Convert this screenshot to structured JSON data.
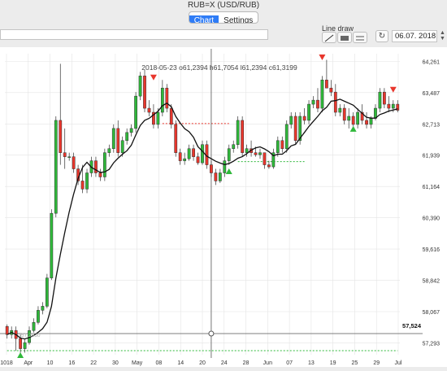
{
  "window": {
    "title": "RUB=X (USD/RUB)"
  },
  "tabs": [
    {
      "label": "Chart",
      "active": true
    },
    {
      "label": "Settings",
      "active": false
    }
  ],
  "toolbar": {
    "symbol_value": "",
    "line_draw_label": "Line draw",
    "date_value": "06.07. 2018"
  },
  "chart_data": {
    "type": "candlestick",
    "info_label": "2018-05-23 o61,2394 h61,7054 l61,2394 c61,3199",
    "y_ticks": [
      "64,261",
      "63,487",
      "62,713",
      "61,939",
      "61,164",
      "60,390",
      "59,616",
      "58,842",
      "58,067",
      "57,293"
    ],
    "x_ticks": [
      "1018",
      "Apr",
      "10",
      "16",
      "22",
      "30",
      "May",
      "08",
      "14",
      "20",
      "24",
      "28",
      "Jun",
      "07",
      "13",
      "19",
      "25",
      "29",
      "Jul"
    ],
    "crosshair_value": "57,524",
    "low_label": "57,2930",
    "ylim": [
      57.0,
      64.45
    ],
    "colors": {
      "up": "#2fb83a",
      "down": "#e8362c",
      "ma": "#111111",
      "grid": "#e4e4e4"
    },
    "candles": [
      [
        57.7,
        57.75,
        57.4,
        57.5
      ],
      [
        57.5,
        57.7,
        57.4,
        57.6
      ],
      [
        57.6,
        57.7,
        57.1,
        57.4
      ],
      [
        57.4,
        57.5,
        57.0,
        57.15
      ],
      [
        57.15,
        57.4,
        57.05,
        57.3
      ],
      [
        57.3,
        57.7,
        57.25,
        57.6
      ],
      [
        57.6,
        57.9,
        57.55,
        57.8
      ],
      [
        57.8,
        58.2,
        57.75,
        58.1
      ],
      [
        58.1,
        58.3,
        58.0,
        58.2
      ],
      [
        58.2,
        59.0,
        58.15,
        58.9
      ],
      [
        58.9,
        60.6,
        58.85,
        60.5
      ],
      [
        60.5,
        62.9,
        60.4,
        62.8
      ],
      [
        62.8,
        64.2,
        61.7,
        62.0
      ],
      [
        62.0,
        62.6,
        61.6,
        61.9
      ],
      [
        61.9,
        62.0,
        61.8,
        61.9
      ],
      [
        61.9,
        62.0,
        61.5,
        61.6
      ],
      [
        61.6,
        61.7,
        61.2,
        61.3
      ],
      [
        61.3,
        61.7,
        61.0,
        61.1
      ],
      [
        61.1,
        61.6,
        61.0,
        61.5
      ],
      [
        61.5,
        61.9,
        61.4,
        61.8
      ],
      [
        61.8,
        61.9,
        61.4,
        61.5
      ],
      [
        61.5,
        61.6,
        61.3,
        61.4
      ],
      [
        61.4,
        62.1,
        61.3,
        62.0
      ],
      [
        62.0,
        62.2,
        61.9,
        62.1
      ],
      [
        62.1,
        62.7,
        62.0,
        62.6
      ],
      [
        62.6,
        62.8,
        61.9,
        62.0
      ],
      [
        62.0,
        62.4,
        61.9,
        62.3
      ],
      [
        62.3,
        62.6,
        62.2,
        62.5
      ],
      [
        62.5,
        62.7,
        62.4,
        62.6
      ],
      [
        62.6,
        63.5,
        62.5,
        63.4
      ],
      [
        63.4,
        64.0,
        63.3,
        63.9
      ],
      [
        63.9,
        64.05,
        63.0,
        63.1
      ],
      [
        63.1,
        63.3,
        62.9,
        63.0
      ],
      [
        63.0,
        63.2,
        62.6,
        62.7
      ],
      [
        62.7,
        63.1,
        62.6,
        63.0
      ],
      [
        63.0,
        63.8,
        62.9,
        63.6
      ],
      [
        63.6,
        63.7,
        63.0,
        63.1
      ],
      [
        63.1,
        63.2,
        62.6,
        62.7
      ],
      [
        62.7,
        62.8,
        61.9,
        62.0
      ],
      [
        62.0,
        62.1,
        61.7,
        61.8
      ],
      [
        61.8,
        62.0,
        61.7,
        61.85
      ],
      [
        61.85,
        62.2,
        61.8,
        62.1
      ],
      [
        62.1,
        62.2,
        61.8,
        61.9
      ],
      [
        61.9,
        62.0,
        61.7,
        61.75
      ],
      [
        61.75,
        62.3,
        61.7,
        62.2
      ],
      [
        62.2,
        62.3,
        61.6,
        61.7
      ],
      [
        61.7,
        61.8,
        61.4,
        61.5
      ],
      [
        61.5,
        61.6,
        61.2,
        61.3
      ],
      [
        61.3,
        61.6,
        61.25,
        61.5
      ],
      [
        61.5,
        61.9,
        61.4,
        61.8
      ],
      [
        61.8,
        62.2,
        61.7,
        62.1
      ],
      [
        62.1,
        62.3,
        62.0,
        62.2
      ],
      [
        62.2,
        62.9,
        62.1,
        62.8
      ],
      [
        62.8,
        62.9,
        61.9,
        62.0
      ],
      [
        62.0,
        62.2,
        61.9,
        62.1
      ],
      [
        62.1,
        62.3,
        61.9,
        62.0
      ],
      [
        62.0,
        62.15,
        61.9,
        61.95
      ],
      [
        61.95,
        62.1,
        61.85,
        62.0
      ],
      [
        62.0,
        62.0,
        61.6,
        61.7
      ],
      [
        61.7,
        61.8,
        61.6,
        61.65
      ],
      [
        61.65,
        62.1,
        61.6,
        62.0
      ],
      [
        62.0,
        62.4,
        61.9,
        62.3
      ],
      [
        62.3,
        62.4,
        62.0,
        62.1
      ],
      [
        62.1,
        62.8,
        62.0,
        62.7
      ],
      [
        62.7,
        63.0,
        62.6,
        62.9
      ],
      [
        62.9,
        63.0,
        62.2,
        62.3
      ],
      [
        62.3,
        63.0,
        62.2,
        62.9
      ],
      [
        62.9,
        63.1,
        62.7,
        62.8
      ],
      [
        62.8,
        63.3,
        62.7,
        63.2
      ],
      [
        63.2,
        63.4,
        63.1,
        63.3
      ],
      [
        63.3,
        63.6,
        63.0,
        63.1
      ],
      [
        63.1,
        63.9,
        63.0,
        63.8
      ],
      [
        63.8,
        64.3,
        63.7,
        63.6
      ],
      [
        63.6,
        63.8,
        63.4,
        63.5
      ],
      [
        63.5,
        63.7,
        62.9,
        63.0
      ],
      [
        63.0,
        63.2,
        62.9,
        63.1
      ],
      [
        63.1,
        63.2,
        62.7,
        62.8
      ],
      [
        62.8,
        63.1,
        62.6,
        62.9
      ],
      [
        62.9,
        63.0,
        62.6,
        62.7
      ],
      [
        62.7,
        63.1,
        62.6,
        63.0
      ],
      [
        63.0,
        63.2,
        62.7,
        62.8
      ],
      [
        62.8,
        63.0,
        62.6,
        62.7
      ],
      [
        62.7,
        62.9,
        62.6,
        62.85
      ],
      [
        62.85,
        63.2,
        62.8,
        63.1
      ],
      [
        63.1,
        63.6,
        63.0,
        63.5
      ],
      [
        63.5,
        63.6,
        63.1,
        63.2
      ],
      [
        63.2,
        63.4,
        63.0,
        63.1
      ],
      [
        63.1,
        63.3,
        63.0,
        63.2
      ],
      [
        63.2,
        63.3,
        63.0,
        63.05
      ]
    ],
    "sell_signals": [
      {
        "index": 33,
        "price": 63.85
      },
      {
        "index": 71,
        "price": 64.35
      },
      {
        "index": 87,
        "price": 63.55
      }
    ],
    "buy_signals": [
      {
        "index": 3,
        "price": 57.0
      },
      {
        "index": 50,
        "price": 61.55
      },
      {
        "index": 78,
        "price": 62.6
      }
    ],
    "levels": [
      {
        "price": 62.72,
        "from": 35,
        "to": 50,
        "color": "#e8362c"
      },
      {
        "price": 61.78,
        "from": 52,
        "to": 67,
        "color": "#2fb83a"
      },
      {
        "price": 57.1,
        "from": 0,
        "to": 88,
        "color": "#2fb83a"
      }
    ],
    "crosshair_index": 46
  }
}
